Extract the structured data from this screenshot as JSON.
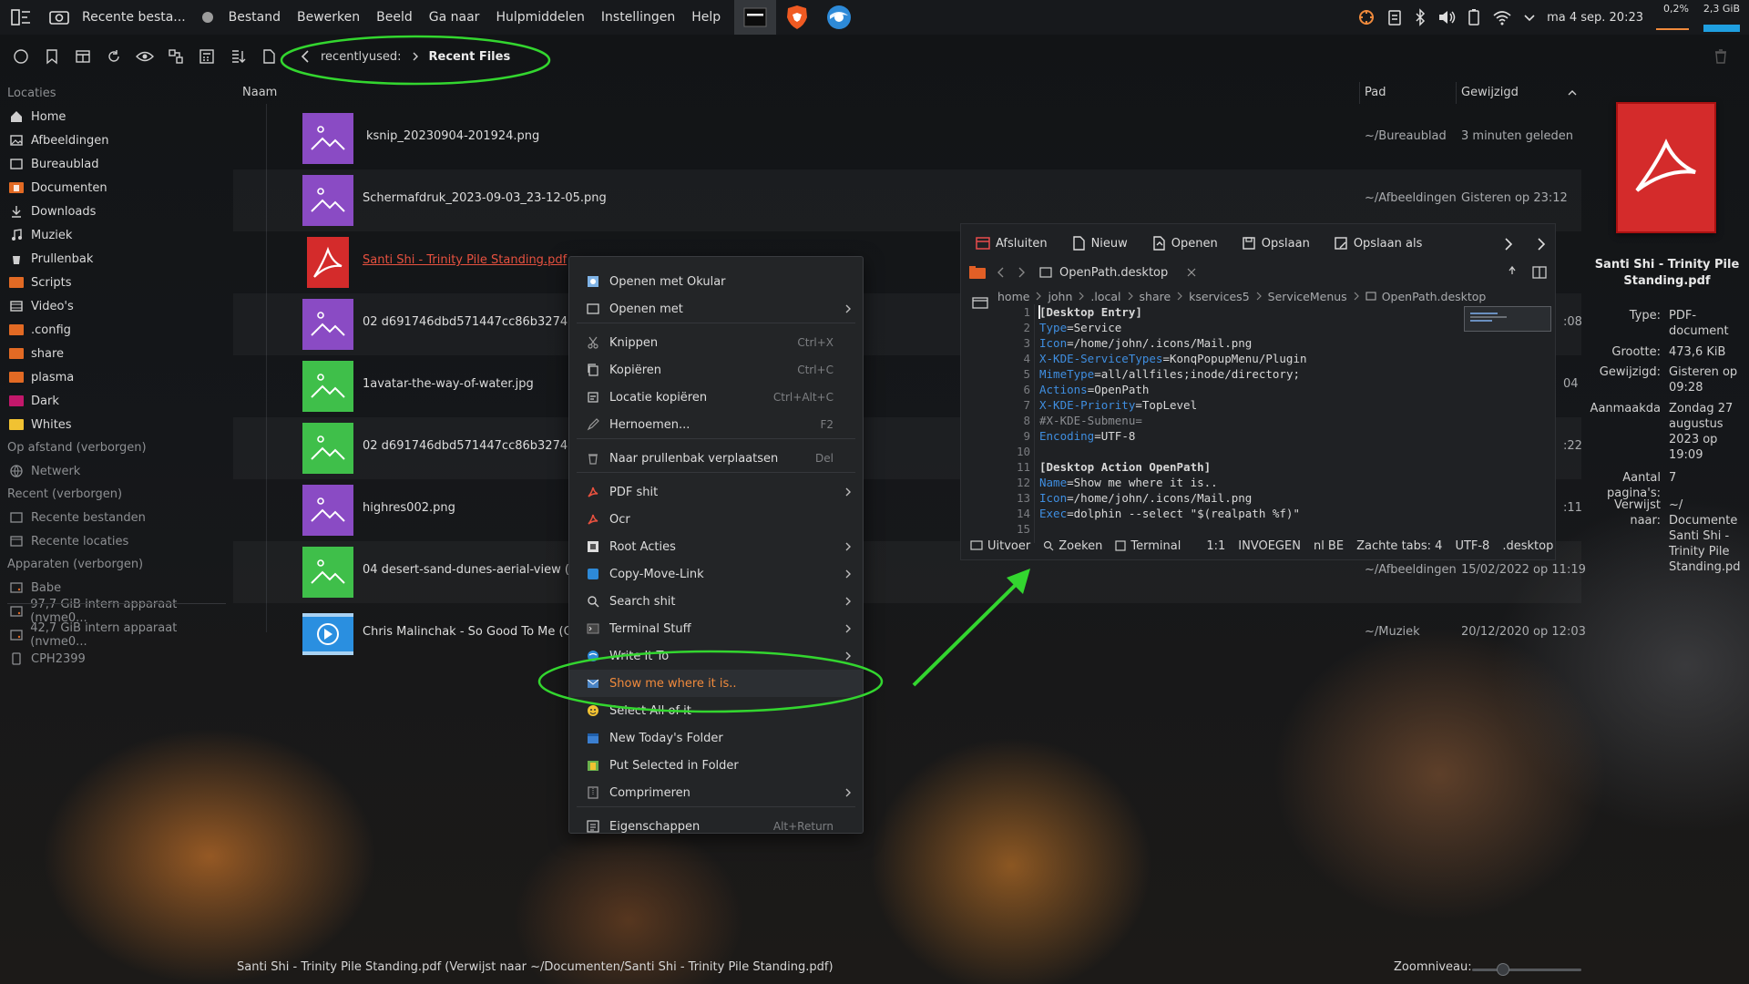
{
  "topbar": {
    "task_title": "Recente besta...",
    "menu": [
      "Bestand",
      "Bewerken",
      "Beeld",
      "Ga naar",
      "Hulpmiddelen",
      "Instellingen",
      "Help"
    ],
    "clock": "ma 4 sep. 20:23",
    "cpu": "0,2%",
    "mem": "2,3 GiB"
  },
  "breadcrumb": {
    "parent": "recentlyused:",
    "current": "Recent Files"
  },
  "sidebar": {
    "locations_head": "Locaties",
    "locations": [
      "Home",
      "Afbeeldingen",
      "Bureaublad",
      "Documenten",
      "Downloads",
      "Muziek",
      "Prullenbak",
      "Scripts",
      "Video's",
      ".config",
      "share",
      "plasma",
      "Dark",
      "Whites"
    ],
    "remote_head": "Op afstand (verborgen)",
    "remote": [
      "Netwerk"
    ],
    "recent_head": "Recent (verborgen)",
    "recent": [
      "Recente bestanden",
      "Recente locaties"
    ],
    "devices_head": "Apparaten (verborgen)",
    "devices": [
      "Babe",
      "97,7 GiB intern apparaat (nvme0...",
      "42,7 GiB intern apparaat (nvme0...",
      "CPH2399"
    ]
  },
  "columns": {
    "name": "Naam",
    "path": "Pad",
    "modified": "Gewijzigd"
  },
  "files": [
    {
      "name": "ksnip_20230904-201924.png",
      "path": "~/Bureaublad",
      "date": "3 minuten geleden",
      "kind": "image-purple"
    },
    {
      "name": "Schermafdruk_2023-09-03_23-12-05.png",
      "path": "~/Afbeeldingen",
      "date": "Gisteren op 23:12",
      "kind": "image-purple"
    },
    {
      "name": "Santi Shi - Trinity Pile Standing.pdf",
      "path": "",
      "date": "",
      "kind": "pdf"
    },
    {
      "name": "02 d691746dbd571447cc86b327454f",
      "path": "",
      "date": "",
      "tail": ":08",
      "kind": "image-purple"
    },
    {
      "name": "1avatar-the-way-of-water.jpg",
      "path": "",
      "date": "",
      "tail": "04",
      "kind": "image-green"
    },
    {
      "name": "02 d691746dbd571447cc86b327454f",
      "path": "",
      "date": "",
      "tail": ":22",
      "kind": "image-green"
    },
    {
      "name": "highres002.png",
      "path": "",
      "date": "",
      "tail": ":11",
      "kind": "image-purple"
    },
    {
      "name": "04 desert-sand-dunes-aerial-view (1).j",
      "path": "~/Afbeeldingen",
      "date": "15/02/2022 op 11:19",
      "kind": "image-green"
    },
    {
      "name": "Chris Malinchak - So Good To Me (Off",
      "path": "~/Muziek",
      "date": "20/12/2020 op 12:03",
      "kind": "video"
    }
  ],
  "context_menu": [
    {
      "label": "Openen met Okular",
      "shortcut": "",
      "sub": false,
      "icon": "okular-icon"
    },
    {
      "label": "Openen met",
      "shortcut": "",
      "sub": true,
      "icon": "open-with-icon"
    },
    {
      "label": "Knippen",
      "shortcut": "Ctrl+X",
      "sub": false,
      "icon": "scissors-icon"
    },
    {
      "label": "Kopiëren",
      "shortcut": "Ctrl+C",
      "sub": false,
      "icon": "copy-icon"
    },
    {
      "label": "Locatie kopiëren",
      "shortcut": "Ctrl+Alt+C",
      "sub": false,
      "icon": "copy-location-icon"
    },
    {
      "label": "Hernoemen...",
      "shortcut": "F2",
      "sub": false,
      "icon": "rename-icon"
    },
    {
      "label": "Naar prullenbak verplaatsen",
      "shortcut": "Del",
      "sub": false,
      "icon": "trash-icon"
    },
    {
      "label": "PDF shit",
      "shortcut": "",
      "sub": true,
      "icon": "pdf-icon"
    },
    {
      "label": "Ocr",
      "shortcut": "",
      "sub": false,
      "icon": "pdf-icon"
    },
    {
      "label": "Root Acties",
      "shortcut": "",
      "sub": true,
      "icon": "root-icon"
    },
    {
      "label": "Copy-Move-Link",
      "shortcut": "",
      "sub": true,
      "icon": "copy-move-icon"
    },
    {
      "label": "Search shit",
      "shortcut": "",
      "sub": true,
      "icon": "search-icon"
    },
    {
      "label": "Terminal Stuff",
      "shortcut": "",
      "sub": true,
      "icon": "terminal-icon"
    },
    {
      "label": "Write It To",
      "shortcut": "",
      "sub": true,
      "icon": "globe-icon"
    },
    {
      "label": "Show me where it is..",
      "shortcut": "",
      "sub": false,
      "icon": "mail-icon"
    },
    {
      "label": "Select All of it",
      "shortcut": "",
      "sub": false,
      "icon": "select-all-icon"
    },
    {
      "label": "New Today's Folder",
      "shortcut": "",
      "sub": false,
      "icon": "calendar-icon"
    },
    {
      "label": "Put Selected in Folder",
      "shortcut": "",
      "sub": false,
      "icon": "folder-put-icon"
    },
    {
      "label": "Comprimeren",
      "shortcut": "",
      "sub": true,
      "icon": "compress-icon"
    },
    {
      "label": "Eigenschappen",
      "shortcut": "Alt+Return",
      "sub": false,
      "icon": "properties-icon"
    }
  ],
  "kate": {
    "toolbar": [
      "Afsluiten",
      "Nieuw",
      "Openen",
      "Opslaan",
      "Opslaan als"
    ],
    "tab": "OpenPath.desktop",
    "path": [
      "home",
      "john",
      ".local",
      "share",
      "kservices5",
      "ServiceMenus",
      "OpenPath.desktop"
    ],
    "lines": [
      [
        "hdr",
        "[Desktop Entry]"
      ],
      [
        "kv",
        "Type",
        "Service"
      ],
      [
        "kv",
        "Icon",
        "/home/john/.icons/Mail.png"
      ],
      [
        "kv",
        "X-KDE-ServiceTypes",
        "KonqPopupMenu/Plugin"
      ],
      [
        "kv",
        "MimeType",
        "all/allfiles;inode/directory;"
      ],
      [
        "kv",
        "Actions",
        "OpenPath"
      ],
      [
        "kv",
        "X-KDE-Priority",
        "TopLevel"
      ],
      [
        "cm",
        "#X-KDE-Submenu="
      ],
      [
        "kv",
        "Encoding",
        "UTF-8"
      ],
      [
        "blank",
        ""
      ],
      [
        "hdr",
        "[Desktop Action OpenPath]"
      ],
      [
        "kv",
        "Name",
        "Show me where it is.."
      ],
      [
        "kv",
        "Icon",
        "/home/john/.icons/Mail.png"
      ],
      [
        "kv",
        "Exec",
        "dolphin --select \"$(realpath %f)\""
      ],
      [
        "blank",
        ""
      ]
    ],
    "status": [
      "Uitvoer",
      "Zoeken",
      "Terminal",
      "1:1",
      "INVOEGEN",
      "nl BE",
      "Zachte tabs: 4",
      "UTF-8",
      ".desktop"
    ]
  },
  "info": {
    "title": "Santi Shi - Trinity Pile Standing.pdf",
    "props": [
      {
        "label": "Type:",
        "value": "PDF-document"
      },
      {
        "label": "Grootte:",
        "value": "473,6 KiB"
      },
      {
        "label": "Gewijzigd:",
        "value": "Gisteren op 09:28"
      },
      {
        "label": "Aanmaakda",
        "value": "Zondag 27 augustus 2023 op 19:09"
      },
      {
        "label": "Aantal pagina's:",
        "value": "7"
      },
      {
        "label": "Verwijst naar:",
        "value": "~/ Documente Santi Shi - Trinity Pile Standing.pd"
      }
    ]
  },
  "statusbar": {
    "text": "Santi Shi - Trinity Pile Standing.pdf (Verwijst naar ~/Documenten/Santi Shi - Trinity Pile Standing.pdf)",
    "zoom_label": "Zoomniveau:"
  },
  "colors": {
    "accent": "#f08a3c",
    "annotation": "#33d62f",
    "link": "#e7513f",
    "keyword": "#3f8ee0"
  }
}
